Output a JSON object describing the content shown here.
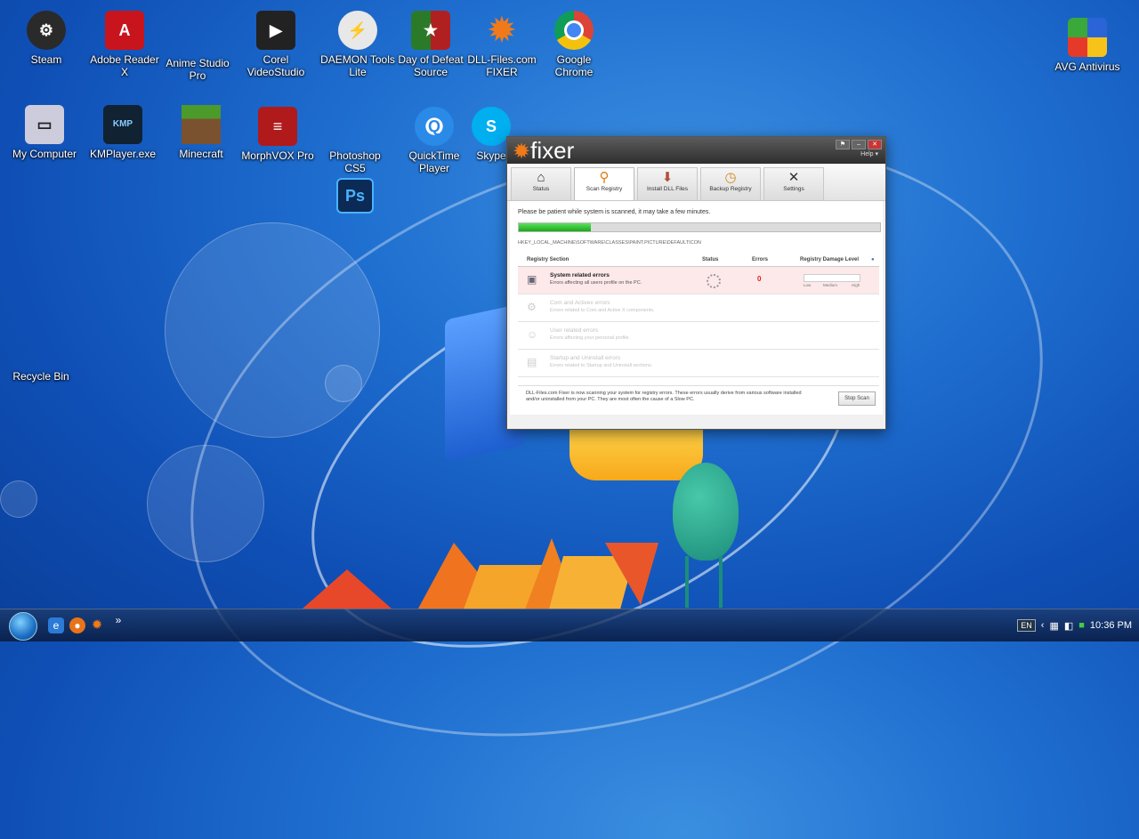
{
  "desktop": {
    "icons": [
      {
        "label": "Steam"
      },
      {
        "label": "Adobe Reader X"
      },
      {
        "label": "Anime Studio Pro"
      },
      {
        "label": "Corel VideoStudio"
      },
      {
        "label": "DAEMON Tools Lite"
      },
      {
        "label": "Day of Defeat Source"
      },
      {
        "label": "DLL-Files.com FIXER"
      },
      {
        "label": "Google Chrome"
      },
      {
        "label": "AVG Antivirus"
      },
      {
        "label": "My Computer"
      },
      {
        "label": "KMPlayer.exe"
      },
      {
        "label": "Minecraft"
      },
      {
        "label": "MorphVOX Pro"
      },
      {
        "label": "Photoshop CS5"
      },
      {
        "label": "QuickTime Player"
      },
      {
        "label": "Skype"
      },
      {
        "label": "Recycle Bin"
      }
    ],
    "ps_badge": "Ps"
  },
  "window": {
    "app_name": "fixer",
    "help_label": "Help ▾",
    "tabs": [
      {
        "label": "Status"
      },
      {
        "label": "Scan Registry"
      },
      {
        "label": "Install DLL Files"
      },
      {
        "label": "Backup Registry"
      },
      {
        "label": "Settings"
      }
    ],
    "scan_message": "Please be patient while system is scanned, it may take a few minutes.",
    "progress": 0.2,
    "current_path": "HKEY_LOCAL_MACHINE\\SOFTWARE\\CLASSES\\PAINT.PICTURE\\DEFAULTICON",
    "table": {
      "headers": [
        "Registry Section",
        "Status",
        "Errors",
        "Registry Damage Level"
      ],
      "rows": [
        {
          "name": "System related errors",
          "desc": "Errors affecting all users profile on the PC.",
          "errors": "0"
        },
        {
          "name": "Com and Activex errors",
          "desc": "Errors related to Com and Active X components."
        },
        {
          "name": "User related errors",
          "desc": "Errors affecting your personal profile."
        },
        {
          "name": "Startup and Uninstall errors",
          "desc": "Errors related to Startup and Uninstall sections."
        }
      ],
      "damage_labels": [
        "Low",
        "Medium",
        "High"
      ]
    },
    "footer_text": "DLL-Files.com Fixer is now scanning your system for registry errors. These errors usually derive from various software installed and/or uninstalled from your PC. They are most often the cause of a Slow PC.",
    "stop_button": "Stop Scan"
  },
  "taskbar": {
    "lang": "EN",
    "time": "10:36 PM"
  }
}
